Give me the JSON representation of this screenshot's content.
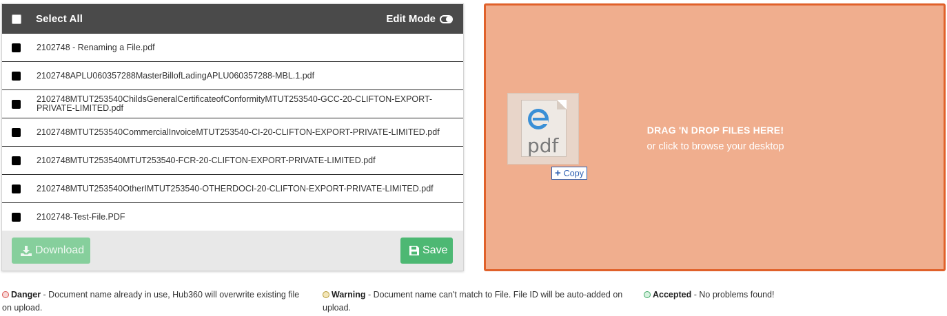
{
  "header": {
    "select_all_label": "Select All",
    "edit_mode_label": "Edit Mode"
  },
  "files": [
    {
      "name": "2102748 - Renaming a File.pdf"
    },
    {
      "name": "2102748APLU060357288MasterBillofLadingAPLU060357288-MBL.1.pdf"
    },
    {
      "name": "2102748MTUT253540ChildsGeneralCertificateofConformityMTUT253540-GCC-20-CLIFTON-EXPORT-PRIVATE-LIMITED.pdf"
    },
    {
      "name": "2102748MTUT253540CommercialInvoiceMTUT253540-CI-20-CLIFTON-EXPORT-PRIVATE-LIMITED.pdf"
    },
    {
      "name": "2102748MTUT253540MTUT253540-FCR-20-CLIFTON-EXPORT-PRIVATE-LIMITED.pdf"
    },
    {
      "name": "2102748MTUT253540OtherIMTUT253540-OTHERDOCI-20-CLIFTON-EXPORT-PRIVATE-LIMITED.pdf"
    },
    {
      "name": "2102748-Test-File.PDF"
    }
  ],
  "footer": {
    "download_label": "Download",
    "save_label": "Save"
  },
  "dropzone": {
    "title": "DRAG 'N DROP FILES HERE!",
    "subtitle": "or click to browse your desktop",
    "drag_icon_label": "pdf",
    "copy_label": "Copy"
  },
  "legend": {
    "danger": {
      "label": "Danger",
      "text": " - Document name already in use, Hub360 will overwrite existing file on upload."
    },
    "warning": {
      "label": "Warning",
      "text": " - Document name can't match to File. File ID will be auto-added on upload."
    },
    "accepted": {
      "label": "Accepted",
      "text": " - No problems found!"
    }
  },
  "colors": {
    "header_bg": "#4a4a4a",
    "dropzone_bg": "#f0ae8e",
    "dropzone_border": "#e0612a",
    "save_green": "#4db873",
    "download_green_disabled": "#86cf9c"
  }
}
